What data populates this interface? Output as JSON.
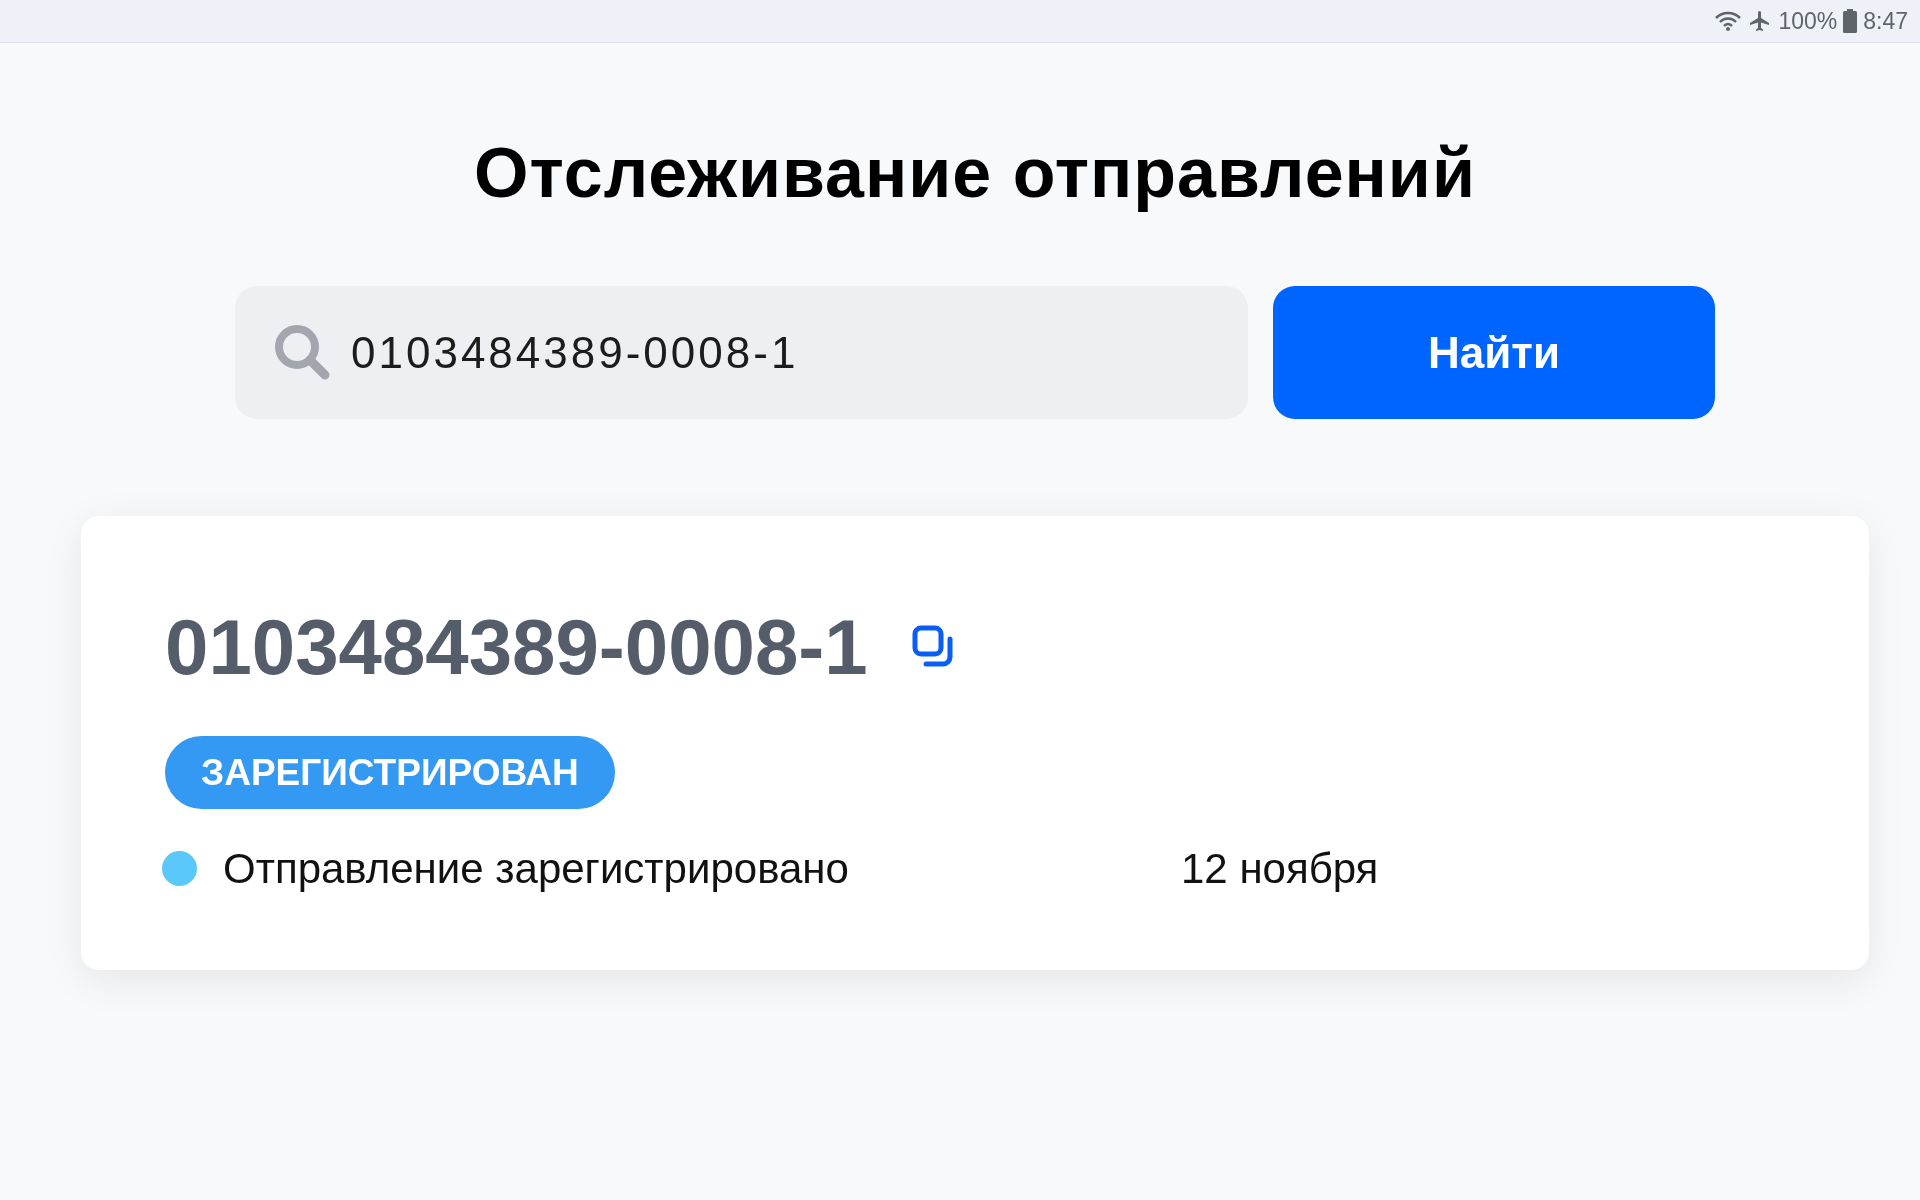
{
  "status_bar": {
    "battery": "100%",
    "time": "8:47"
  },
  "title": "Отслеживание отправлений",
  "search": {
    "value": "0103484389-0008-1",
    "button": "Найти"
  },
  "shipment": {
    "number": "0103484389-0008-1",
    "status": "ЗАРЕГИСТРИРОВАН",
    "events": [
      {
        "text": "Отправление зарегистрировано",
        "date": "12 ноября",
        "color": "#5ac8fa"
      }
    ]
  }
}
